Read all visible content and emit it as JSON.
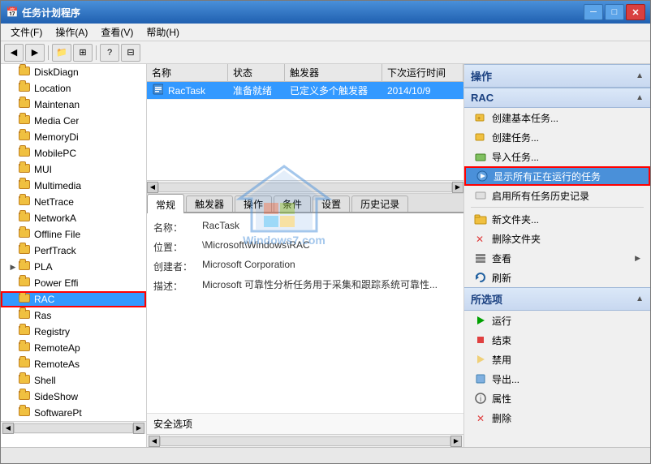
{
  "window": {
    "title": "任务计划程序",
    "title_icon": "📅"
  },
  "menubar": {
    "items": [
      "文件(F)",
      "操作(A)",
      "查看(V)",
      "帮助(H)"
    ]
  },
  "toolbar": {
    "buttons": [
      "←",
      "→",
      "📁",
      "▦",
      "?",
      "▦"
    ]
  },
  "sidebar": {
    "items": [
      {
        "label": "DiskDiagn",
        "selected": false,
        "has_arrow": false
      },
      {
        "label": "Location",
        "selected": false,
        "has_arrow": false
      },
      {
        "label": "Maintenan",
        "selected": false,
        "has_arrow": false
      },
      {
        "label": "Media Cer",
        "selected": false,
        "has_arrow": false
      },
      {
        "label": "MemoryDi",
        "selected": false,
        "has_arrow": false
      },
      {
        "label": "MobilePC",
        "selected": false,
        "has_arrow": false
      },
      {
        "label": "MUI",
        "selected": false,
        "has_arrow": false
      },
      {
        "label": "Multimedia",
        "selected": false,
        "has_arrow": false
      },
      {
        "label": "NetTrace",
        "selected": false,
        "has_arrow": false
      },
      {
        "label": "NetworkA",
        "selected": false,
        "has_arrow": false
      },
      {
        "label": "Offline File",
        "selected": false,
        "has_arrow": false
      },
      {
        "label": "PerfTrack",
        "selected": false,
        "has_arrow": false
      },
      {
        "label": "PLA",
        "selected": false,
        "has_arrow": true
      },
      {
        "label": "Power Effi",
        "selected": false,
        "has_arrow": false
      },
      {
        "label": "RAC",
        "selected": true,
        "has_arrow": false,
        "rac": true
      },
      {
        "label": "Ras",
        "selected": false,
        "has_arrow": false
      },
      {
        "label": "Registry",
        "selected": false,
        "has_arrow": false
      },
      {
        "label": "RemoteAp",
        "selected": false,
        "has_arrow": false
      },
      {
        "label": "RemoteAs",
        "selected": false,
        "has_arrow": false
      },
      {
        "label": "Shell",
        "selected": false,
        "has_arrow": false
      },
      {
        "label": "SideShow",
        "selected": false,
        "has_arrow": false
      },
      {
        "label": "SoftwarePt",
        "selected": false,
        "has_arrow": false
      }
    ]
  },
  "tasklist": {
    "columns": [
      {
        "label": "名称",
        "width": 100
      },
      {
        "label": "状态",
        "width": 70
      },
      {
        "label": "触发器",
        "width": 120
      },
      {
        "label": "下次运行时间",
        "width": 100
      }
    ],
    "rows": [
      {
        "icon": "task",
        "name": "RacTask",
        "status": "准备就绪",
        "trigger": "已定义多个触发器",
        "next_run": "2014/10/9"
      }
    ]
  },
  "detail_tabs": {
    "tabs": [
      "常规",
      "触发器",
      "操作",
      "条件",
      "设置",
      "历史记录"
    ],
    "active": 0,
    "fields": {
      "name_label": "名称：",
      "name_value": "RacTask",
      "location_label": "位置：",
      "location_value": "\\Microsoft\\Windows\\RAC",
      "creator_label": "创建者：",
      "creator_value": "Microsoft Corporation",
      "desc_label": "描述：",
      "desc_value": "Microsoft 可靠性分析任务用于采集和跟踪系统可靠性...",
      "security_label": "安全选项"
    }
  },
  "right_panel": {
    "sections": [
      {
        "header": "操作",
        "items": []
      },
      {
        "header": "RAC",
        "items": [
          {
            "label": "创建基本任务...",
            "icon": "create",
            "highlighted": false
          },
          {
            "label": "创建任务...",
            "icon": "create2",
            "highlighted": false
          },
          {
            "label": "导入任务...",
            "icon": "import",
            "highlighted": false
          },
          {
            "label": "显示所有正在运行的任务",
            "icon": "show",
            "highlighted": true
          },
          {
            "label": "启用所有任务历史记录",
            "icon": "enable",
            "highlighted": false
          },
          {
            "sep": true
          },
          {
            "label": "新文件夹...",
            "icon": "folder",
            "highlighted": false
          },
          {
            "label": "删除文件夹",
            "icon": "delete",
            "highlighted": false
          },
          {
            "label": "查看",
            "icon": "view",
            "highlighted": false,
            "sub": true
          },
          {
            "label": "刷新",
            "icon": "refresh",
            "highlighted": false
          }
        ]
      },
      {
        "header": "所选项",
        "items": [
          {
            "label": "运行",
            "icon": "run",
            "highlighted": false
          },
          {
            "label": "结束",
            "icon": "end",
            "highlighted": false
          },
          {
            "label": "禁用",
            "icon": "disable",
            "highlighted": false
          },
          {
            "label": "导出...",
            "icon": "export",
            "highlighted": false
          },
          {
            "label": "属性",
            "icon": "props",
            "highlighted": false
          },
          {
            "label": "删除",
            "icon": "del2",
            "highlighted": false
          }
        ]
      }
    ]
  }
}
